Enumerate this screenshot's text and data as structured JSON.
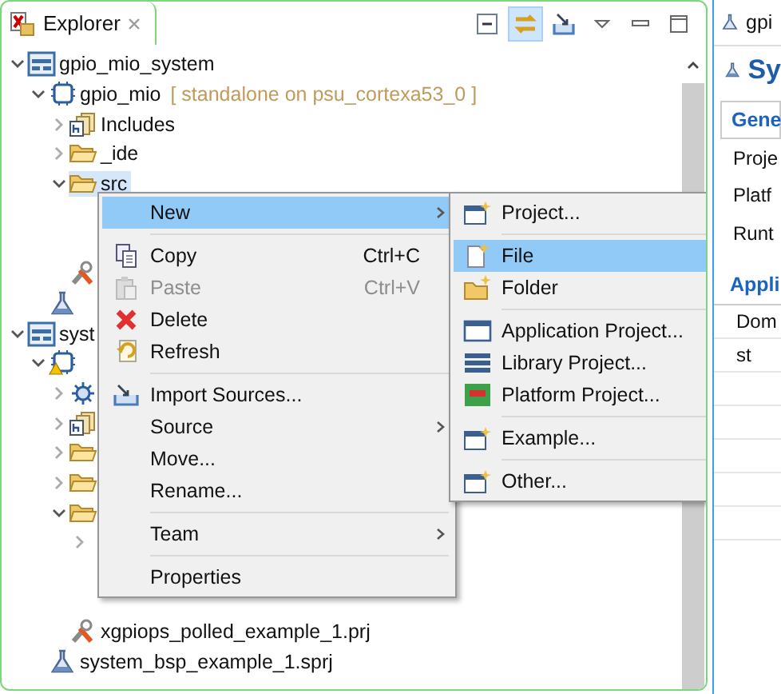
{
  "explorer": {
    "tab": "Explorer",
    "toolbar": [
      {
        "on": false
      },
      {
        "on": true
      },
      {
        "on": false
      },
      {
        "on": false
      },
      {
        "on": false
      },
      {
        "on": false
      }
    ],
    "tree": [
      {
        "kind": "system",
        "label": "gpio_mio_system",
        "selected": false,
        "expanded": true,
        "children": [
          {
            "kind": "app",
            "label": "gpio_mio",
            "note": "[ standalone on psu_cortexa53_0 ]",
            "selected": false,
            "expanded": true,
            "children": [
              {
                "kind": "includes",
                "label": "Includes",
                "selected": false,
                "expanded": false
              },
              {
                "kind": "folder",
                "label": "_ide",
                "selected": false,
                "expanded": false
              },
              {
                "kind": "folder",
                "label": "src",
                "selected": true,
                "expanded": true
              },
              {
                "kind": "prj",
                "selected": false
              }
            ]
          },
          {
            "kind": "flask",
            "selected": false
          }
        ]
      },
      {
        "kind": "system",
        "label": "syst",
        "selected": false,
        "expanded": true,
        "children": [
          {
            "kind": "app-warning",
            "selected": false,
            "expanded": true,
            "children": [
              {
                "kind": "gear",
                "selected": false,
                "expanded": false
              },
              {
                "kind": "includes",
                "selected": false,
                "expanded": false
              },
              {
                "kind": "folder",
                "selected": false,
                "expanded": false
              },
              {
                "kind": "folder",
                "selected": false,
                "expanded": false
              },
              {
                "kind": "folder",
                "selected": false,
                "expanded": true,
                "children": [
                  {
                    "selected": false,
                    "expanded": false
                  }
                ]
              },
              {
                "kind": "prj",
                "label": "xgpiops_polled_example_1.prj",
                "selected": false
              }
            ]
          },
          {
            "kind": "flask",
            "label": "system_bsp_example_1.sprj",
            "selected": false
          }
        ]
      }
    ]
  },
  "context_menu": [
    {
      "kind": "item",
      "label": "New",
      "submenu": true,
      "selected": true,
      "disabled": false
    },
    {
      "kind": "separator"
    },
    {
      "kind": "item",
      "label": "Copy",
      "shortcut": "Ctrl+C",
      "submenu": false,
      "selected": false,
      "disabled": false
    },
    {
      "kind": "item",
      "label": "Paste",
      "shortcut": "Ctrl+V",
      "submenu": false,
      "selected": false,
      "disabled": true
    },
    {
      "kind": "item",
      "label": "Delete",
      "submenu": false,
      "selected": false,
      "disabled": false
    },
    {
      "kind": "item",
      "label": "Refresh",
      "submenu": false,
      "selected": false,
      "disabled": false
    },
    {
      "kind": "separator"
    },
    {
      "kind": "item",
      "label": "Import Sources...",
      "submenu": false,
      "selected": false,
      "disabled": false
    },
    {
      "kind": "item",
      "label": "Source",
      "submenu": true,
      "selected": false,
      "disabled": false
    },
    {
      "kind": "item",
      "label": "Move...",
      "submenu": false,
      "selected": false,
      "disabled": false
    },
    {
      "kind": "item",
      "label": "Rename...",
      "submenu": false,
      "selected": false,
      "disabled": false
    },
    {
      "kind": "separator"
    },
    {
      "kind": "item",
      "label": "Team",
      "submenu": true,
      "selected": false,
      "disabled": false
    },
    {
      "kind": "separator"
    },
    {
      "kind": "item",
      "label": "Properties",
      "submenu": false,
      "selected": false,
      "disabled": false
    }
  ],
  "new_submenu": [
    {
      "kind": "item",
      "label": "Project...",
      "selected": false
    },
    {
      "kind": "separator"
    },
    {
      "kind": "item",
      "label": "File",
      "selected": true
    },
    {
      "kind": "item",
      "label": "Folder",
      "selected": false
    },
    {
      "kind": "separator"
    },
    {
      "kind": "item",
      "label": "Application Project...",
      "selected": false
    },
    {
      "kind": "item",
      "label": "Library Project...",
      "selected": false
    },
    {
      "kind": "item",
      "label": "Platform Project...",
      "selected": false
    },
    {
      "kind": "separator"
    },
    {
      "kind": "item",
      "label": "Example...",
      "selected": false
    },
    {
      "kind": "separator"
    },
    {
      "kind": "item",
      "label": "Other...",
      "selected": false
    }
  ],
  "side_panel": {
    "tab": "gpi",
    "title": "Sy",
    "tabs": [
      {
        "label": "Gene",
        "selected": true
      }
    ],
    "fields": [
      "Proje",
      "Platf",
      "Runt"
    ],
    "section": "Appli",
    "rows": [
      "Dom",
      "st"
    ]
  }
}
